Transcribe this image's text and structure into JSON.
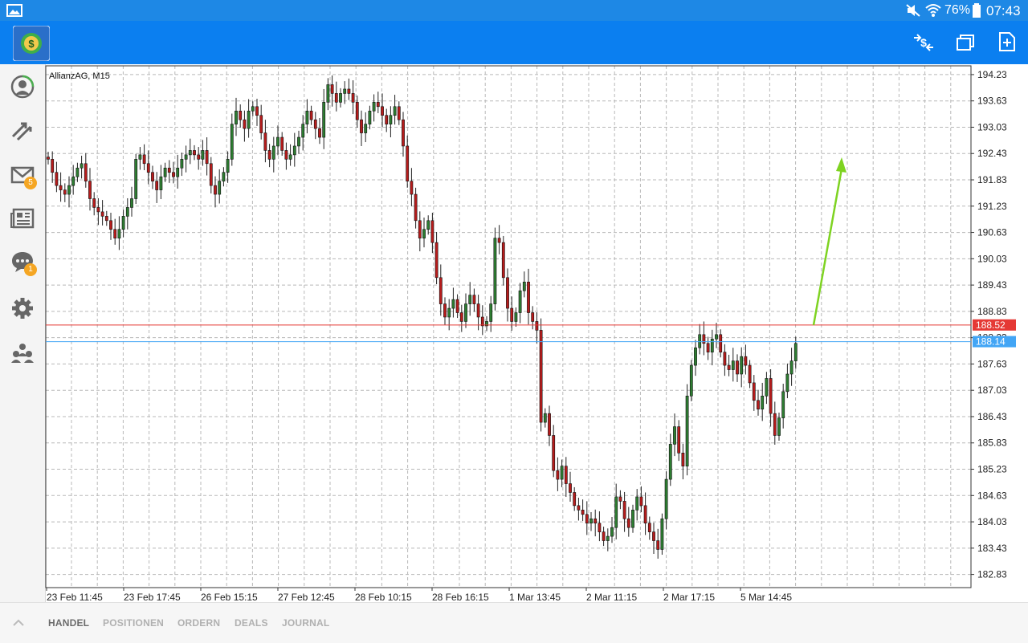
{
  "status_bar": {
    "battery_percent": "76%",
    "time": "07:43",
    "icons": [
      "gallery-icon",
      "mute-icon",
      "wifi-icon",
      "battery-icon"
    ]
  },
  "app_bar": {
    "logo": "metatrader-logo",
    "actions": [
      "trade-icon",
      "windows-icon",
      "new-document-icon"
    ]
  },
  "sidebar": {
    "items": [
      {
        "icon": "account-icon"
      },
      {
        "icon": "trade-arrows-icon"
      },
      {
        "icon": "mail-icon",
        "badge": "5"
      },
      {
        "icon": "news-icon"
      },
      {
        "icon": "chat-icon",
        "badge": "1"
      },
      {
        "icon": "settings-icon"
      },
      {
        "icon": "community-icon"
      }
    ]
  },
  "chart": {
    "symbol_label": "AllianzAG, M15",
    "price_labels": [
      "194.23",
      "193.63",
      "193.03",
      "192.43",
      "191.83",
      "191.23",
      "190.63",
      "190.03",
      "189.43",
      "188.83",
      "188.23",
      "187.63",
      "187.03",
      "186.43",
      "185.83",
      "185.23",
      "184.63",
      "184.03",
      "183.43",
      "182.83"
    ],
    "time_labels": [
      "23 Feb 11:45",
      "23 Feb 17:45",
      "26 Feb 15:15",
      "27 Feb 12:45",
      "28 Feb 10:15",
      "28 Feb 16:15",
      "1 Mar 13:45",
      "2 Mar 11:15",
      "2 Mar 17:15",
      "5 Mar 14:45"
    ],
    "red_line": {
      "price": 188.52,
      "label": "188.52",
      "color": "#e53935"
    },
    "blue_line": {
      "price": 188.14,
      "label": "188.14",
      "color": "#42a5f5"
    },
    "bull_color": "#2e7d32",
    "bear_color": "#b71c1c",
    "trend_arrow_color": "#7ed321"
  },
  "chart_data": {
    "type": "candlestick",
    "title": "AllianzAG, M15",
    "ylim": [
      182.53,
      194.43
    ],
    "x_tick_labels": [
      "23 Feb 11:45",
      "23 Feb 17:45",
      "26 Feb 15:15",
      "27 Feb 12:45",
      "28 Feb 10:15",
      "28 Feb 16:15",
      "1 Mar 13:45",
      "2 Mar 11:15",
      "2 Mar 17:15",
      "5 Mar 14:45"
    ],
    "close_series": [
      192.3,
      192.0,
      191.7,
      191.6,
      191.5,
      191.7,
      191.9,
      192.1,
      192.2,
      191.8,
      191.4,
      191.2,
      191.1,
      191.0,
      190.9,
      190.7,
      190.5,
      190.7,
      191.0,
      191.2,
      191.4,
      192.3,
      192.4,
      192.2,
      192.0,
      191.8,
      191.6,
      191.9,
      192.1,
      192.0,
      191.9,
      192.1,
      192.3,
      192.4,
      192.5,
      192.4,
      192.3,
      192.5,
      192.2,
      191.7,
      191.5,
      191.8,
      192.0,
      192.3,
      193.1,
      193.4,
      193.2,
      193.0,
      193.4,
      193.5,
      193.3,
      192.9,
      192.5,
      192.3,
      192.6,
      192.8,
      192.5,
      192.3,
      192.4,
      192.6,
      192.8,
      193.1,
      193.4,
      193.2,
      193.0,
      192.8,
      193.6,
      194.0,
      193.8,
      193.6,
      193.8,
      193.9,
      193.8,
      193.6,
      193.2,
      192.9,
      193.1,
      193.4,
      193.6,
      193.5,
      193.3,
      193.1,
      193.3,
      193.5,
      193.2,
      192.6,
      191.8,
      191.5,
      190.9,
      190.5,
      190.7,
      190.9,
      190.4,
      189.6,
      189.0,
      188.7,
      188.9,
      189.1,
      188.8,
      188.6,
      189.0,
      189.2,
      189.0,
      188.7,
      188.5,
      188.6,
      189.0,
      190.5,
      190.4,
      189.6,
      188.9,
      188.6,
      188.8,
      189.3,
      189.5,
      188.8,
      188.6,
      188.4,
      186.3,
      186.5,
      186.0,
      185.2,
      185.0,
      185.3,
      184.9,
      184.7,
      184.4,
      184.3,
      184.2,
      184.0,
      184.1,
      184.0,
      183.8,
      183.6,
      183.7,
      183.9,
      184.6,
      184.5,
      184.1,
      183.9,
      184.3,
      184.6,
      184.4,
      184.0,
      183.8,
      183.6,
      183.4,
      184.1,
      185.0,
      185.8,
      186.2,
      185.6,
      185.3,
      186.9,
      187.6,
      188.0,
      188.3,
      188.1,
      187.9,
      188.2,
      188.3,
      187.9,
      187.6,
      187.5,
      187.7,
      187.4,
      187.8,
      187.6,
      187.2,
      186.8,
      186.6,
      186.9,
      187.3,
      186.5,
      186.0,
      186.4,
      187.0,
      187.4,
      187.7,
      188.1
    ]
  }
}
